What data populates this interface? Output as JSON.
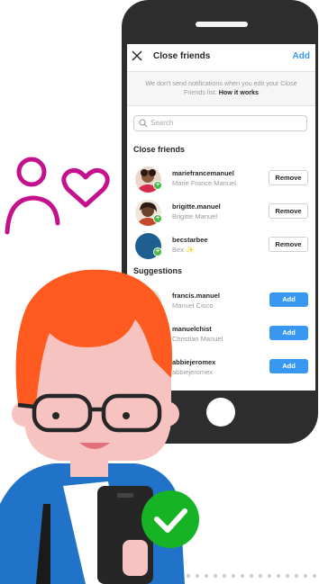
{
  "header": {
    "title": "Close friends",
    "action": "Add"
  },
  "notice": {
    "line1": "We don't send notifications when you edit your Close",
    "line2": "Friends list.",
    "link": "How it works"
  },
  "search": {
    "placeholder": "Search"
  },
  "sections": {
    "close_friends": "Close friends",
    "suggestions": "Suggestions"
  },
  "close_friends": [
    {
      "username": "mariefrancemanuel",
      "name": "Marie France Manuel",
      "action": "Remove"
    },
    {
      "username": "brigitte.manuel",
      "name": "Brigitte Manuel",
      "action": "Remove"
    },
    {
      "username": "becstarbee",
      "name": "Bex ✨",
      "action": "Remove"
    }
  ],
  "suggestions": [
    {
      "username": "francis.manuel",
      "name": "Manuel Cisco",
      "action": "Add"
    },
    {
      "username": "manuelchist",
      "name": "Christian Manuel",
      "action": "Add"
    },
    {
      "username": "abbiejeromex",
      "name": "abbiejeromex",
      "action": "Add"
    }
  ],
  "colors": {
    "accent": "#3897f0",
    "badge": "#4cb84c",
    "icon_magenta": "#c4128c",
    "hair": "#ff5a1f",
    "check": "#16b325"
  },
  "icons": [
    "close-icon",
    "search-icon",
    "close-friends-people-icon",
    "checkmark-icon"
  ]
}
